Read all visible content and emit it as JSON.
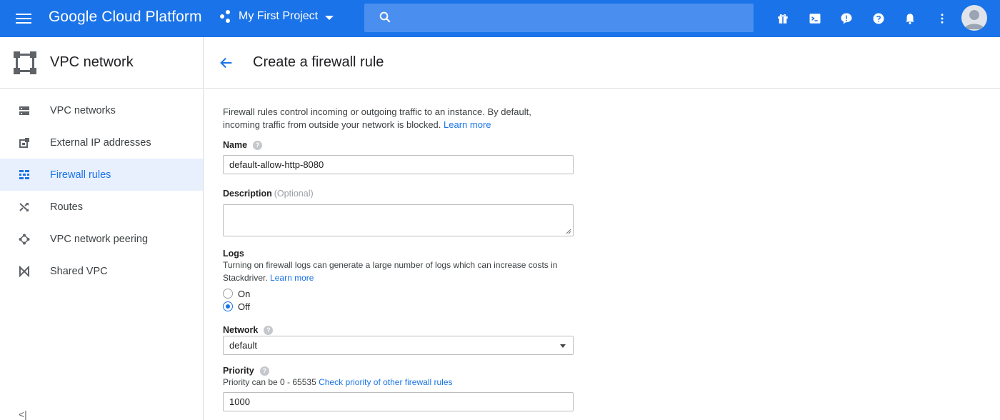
{
  "topbar": {
    "brand": "Google Cloud Platform",
    "project": "My First Project",
    "icons": [
      "gift-icon",
      "terminal-icon",
      "feedback-icon",
      "help-icon",
      "notifications-icon",
      "more-vert-icon"
    ],
    "accent": "#1a73e8"
  },
  "sidebar": {
    "title": "VPC network",
    "items": [
      {
        "label": "VPC networks",
        "icon": "vpc-networks-icon",
        "active": false
      },
      {
        "label": "External IP addresses",
        "icon": "external-ip-icon",
        "active": false
      },
      {
        "label": "Firewall rules",
        "icon": "firewall-icon",
        "active": true
      },
      {
        "label": "Routes",
        "icon": "routes-icon",
        "active": false
      },
      {
        "label": "VPC network peering",
        "icon": "peering-icon",
        "active": false
      },
      {
        "label": "Shared VPC",
        "icon": "shared-vpc-icon",
        "active": false
      }
    ],
    "collapse_label": "<|"
  },
  "main": {
    "title": "Create a firewall rule",
    "intro": "Firewall rules control incoming or outgoing traffic to an instance. By default, incoming traffic from outside your network is blocked.",
    "intro_link": "Learn more",
    "name": {
      "label": "Name",
      "value": "default-allow-http-8080"
    },
    "description": {
      "label": "Description",
      "optional": "(Optional)",
      "value": ""
    },
    "logs": {
      "label": "Logs",
      "help": "Turning on firewall logs can generate a large number of logs which can increase costs in Stackdriver.",
      "link": "Learn more",
      "options": [
        {
          "label": "On",
          "checked": false
        },
        {
          "label": "Off",
          "checked": true
        }
      ]
    },
    "network": {
      "label": "Network",
      "value": "default"
    },
    "priority": {
      "label": "Priority",
      "help": "Priority can be 0 - 65535",
      "link": "Check priority of other firewall rules",
      "value": "1000"
    }
  }
}
